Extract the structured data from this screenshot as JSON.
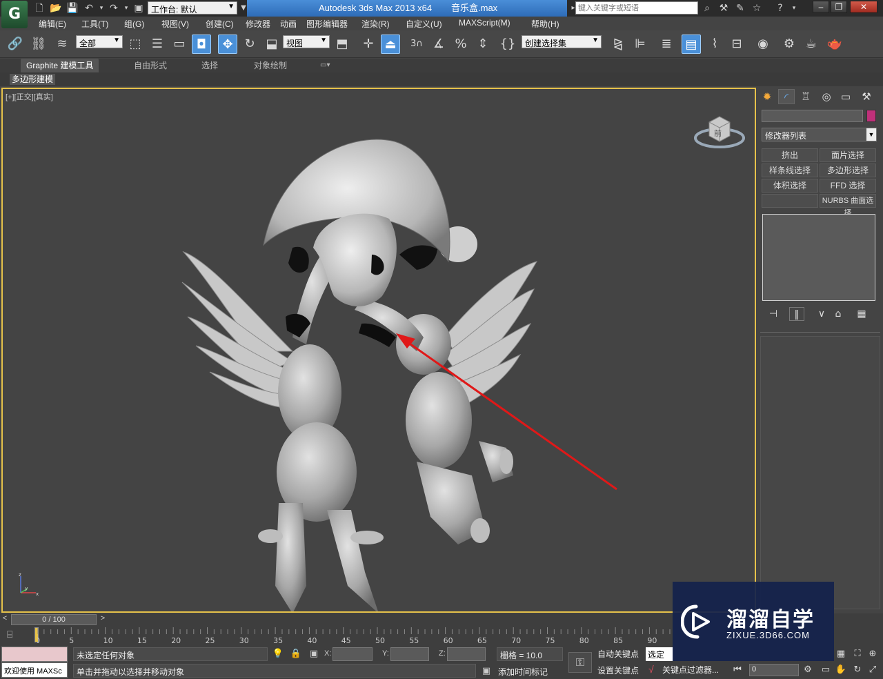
{
  "titlebar": {
    "workspace_label": "工作台: 默认",
    "app_title": "Autodesk 3ds Max  2013 x64",
    "file_name": "音乐盒.max",
    "search_placeholder": "键入关键字或短语"
  },
  "menu": {
    "items": [
      "编辑(E)",
      "工具(T)",
      "组(G)",
      "视图(V)",
      "创建(C)",
      "修改器",
      "动画",
      "图形编辑器",
      "渲染(R)",
      "自定义(U)",
      "MAXScript(M)",
      "帮助(H)"
    ]
  },
  "toolbar": {
    "selection_filter": "全部",
    "ref_coord": "视图",
    "named_selection": "创建选择集",
    "snap_label": "3"
  },
  "ribbon": {
    "tabs": [
      "Graphite 建模工具",
      "自由形式",
      "选择",
      "对象绘制"
    ],
    "active_panel": "多边形建模"
  },
  "viewport": {
    "label": "[+][正交][真实]",
    "viewcube_face": "前"
  },
  "command_panel": {
    "modifier_list": "修改器列表",
    "buttons": [
      "挤出",
      "面片选择",
      "样条线选择",
      "多边形选择",
      "体积选择",
      "FFD 选择",
      "",
      "NURBS 曲面选择"
    ],
    "object_color": "#c0307a"
  },
  "timeline": {
    "frame_display": "0 / 100",
    "ticks": [
      "0",
      "5",
      "10",
      "15",
      "20",
      "25",
      "30",
      "35",
      "40",
      "45",
      "50",
      "55",
      "60",
      "65",
      "70",
      "75",
      "80",
      "85",
      "90"
    ]
  },
  "status": {
    "selection_status": "未选定任何对象",
    "prompt": "单击并拖动以选择并移动对象",
    "maxscript": "欢迎使用 MAXSc",
    "x_label": "X:",
    "y_label": "Y:",
    "z_label": "Z:",
    "grid": "栅格 = 10.0",
    "add_time_tag": "添加时间标记",
    "auto_key": "自动关键点",
    "set_key": "设置关键点",
    "selected_dropdown": "选定对",
    "key_filters": "关键点过滤器...",
    "frame": "0"
  },
  "watermark": {
    "title": "溜溜自学",
    "url": "ZIXUE.3D66.COM"
  },
  "colors": {
    "viewport_border": "#e6c24a",
    "title_bar": "#2e6cb8",
    "annotation_arrow": "#e01818"
  }
}
